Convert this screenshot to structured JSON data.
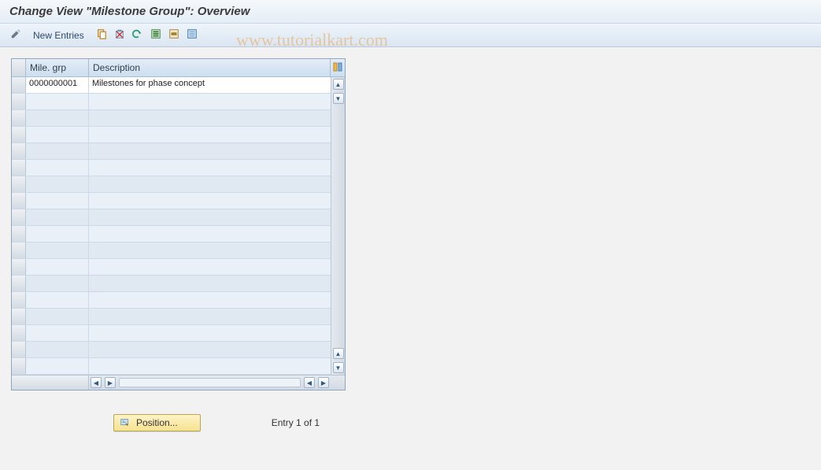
{
  "header": {
    "title": "Change View \"Milestone Group\": Overview"
  },
  "toolbar": {
    "display_change_icon": "pencil-icon",
    "new_entries_label": "New Entries",
    "copy_icon": "copy-icon",
    "delete_icon": "delete-icon",
    "undo_icon": "undo-icon",
    "select_all_icon": "select-all-icon",
    "select_block_icon": "select-block-icon",
    "deselect_icon": "deselect-icon"
  },
  "watermark": "www.tutorialkart.com",
  "grid": {
    "columns": {
      "id": "Mile. grp",
      "desc": "Description"
    },
    "config_icon": "columns-icon",
    "rows": [
      {
        "id": "0000000001",
        "desc": "Milestones for phase concept"
      }
    ],
    "empty_row_count": 17
  },
  "footer": {
    "position_label": "Position...",
    "position_icon": "detail-icon",
    "entry_text": "Entry 1 of 1"
  }
}
